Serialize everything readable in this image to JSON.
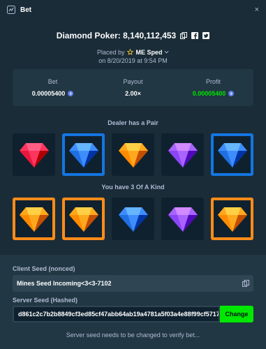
{
  "header": {
    "title": "Bet",
    "close_symbol": "×"
  },
  "game": {
    "title": "Diamond Poker: 8,140,112,453"
  },
  "placed": {
    "prefix": "Placed by",
    "user": "ME Sped",
    "date": "on 8/20/2019 at 9:54 PM"
  },
  "stats": {
    "bet_label": "Bet",
    "bet_value": "0.00005400",
    "payout_label": "Payout",
    "payout_value": "2.00×",
    "profit_label": "Profit",
    "profit_value": "0.00005400"
  },
  "dealer": {
    "label": "Dealer has a Pair",
    "cards": [
      {
        "gem": "red",
        "highlight": "none"
      },
      {
        "gem": "blue",
        "highlight": "blue"
      },
      {
        "gem": "orange",
        "highlight": "none"
      },
      {
        "gem": "purple",
        "highlight": "none"
      },
      {
        "gem": "blue",
        "highlight": "blue"
      }
    ]
  },
  "player": {
    "label": "You have 3 Of A Kind",
    "cards": [
      {
        "gem": "orange",
        "highlight": "orange"
      },
      {
        "gem": "orange",
        "highlight": "orange"
      },
      {
        "gem": "blue",
        "highlight": "none"
      },
      {
        "gem": "purple",
        "highlight": "none"
      },
      {
        "gem": "orange",
        "highlight": "orange"
      }
    ]
  },
  "seeds": {
    "client_label": "Client Seed (nonced)",
    "client_value": "Mines Seed Incoming<3<3-7102",
    "server_label": "Server Seed (Hashed)",
    "server_value": "d861c2c7b2b8849cf3ed85cf47abb64ab19a4781a5f03a4e88f99cf5717",
    "change_label": "Change",
    "note": "Server seed needs to be changed to verify bet..."
  },
  "colors": {
    "background": "#1a2c38",
    "panel": "#213743",
    "accent_green": "#00e701",
    "highlight_blue": "#1475e1",
    "highlight_orange": "#ff8c1a",
    "gem_red": "#e8173f",
    "gem_blue": "#1f6fe0",
    "gem_orange": "#ff8a00",
    "gem_purple": "#8b45f5"
  }
}
